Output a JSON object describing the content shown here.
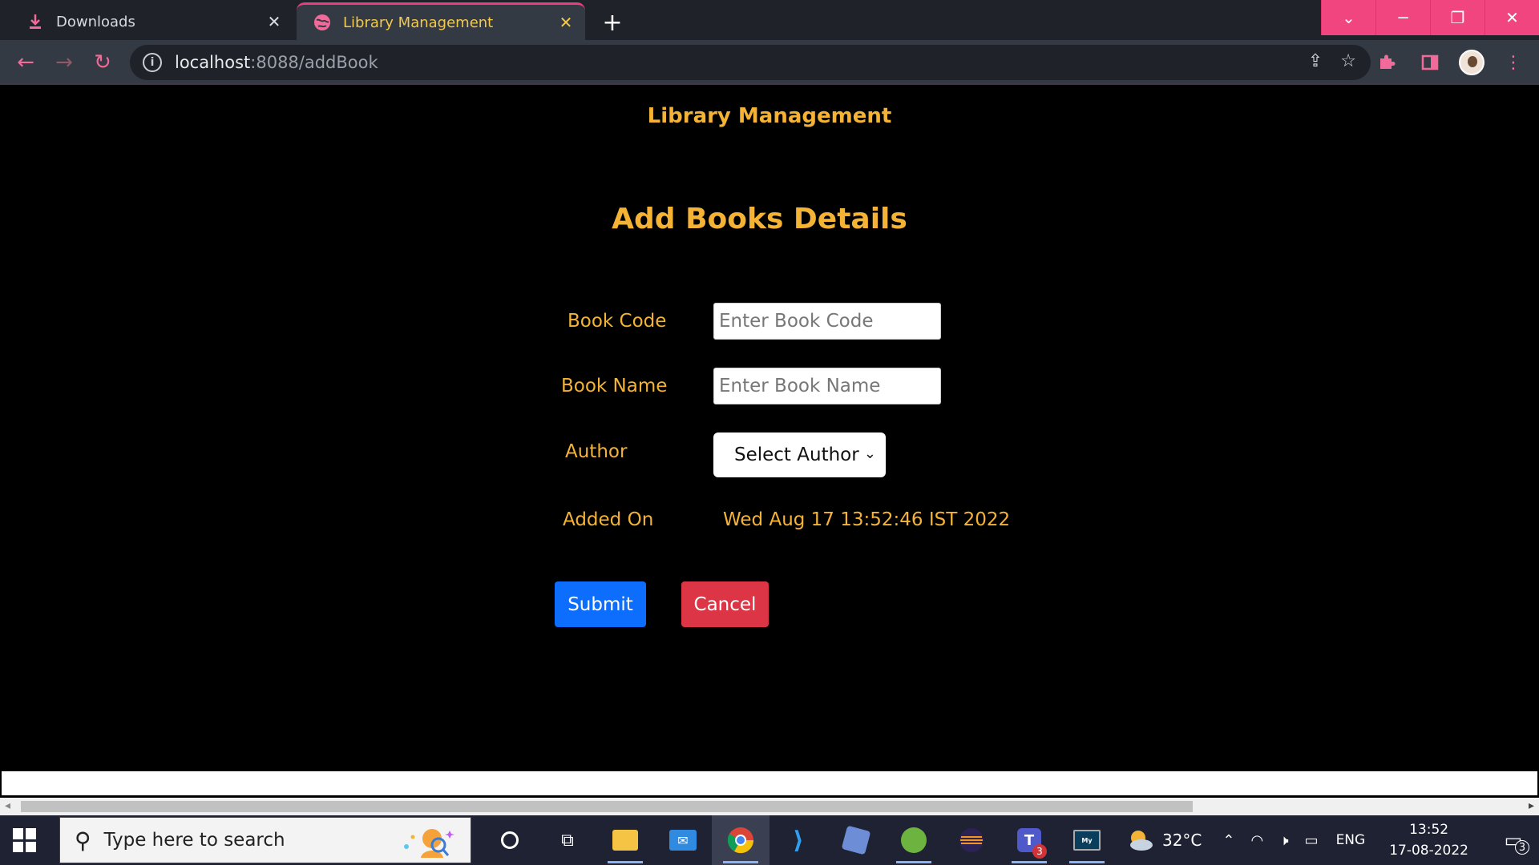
{
  "browser": {
    "tabs": [
      {
        "title": "Downloads",
        "icon": "download-icon"
      },
      {
        "title": "Library Management",
        "icon": "globe-icon",
        "active": true
      }
    ],
    "url_host": "localhost",
    "url_path": ":8088/addBook",
    "accent_color": "#f1457f"
  },
  "page": {
    "brand": "Library Management",
    "heading": "Add Books Details",
    "form": {
      "book_code_label": "Book Code",
      "book_code_placeholder": "Enter Book Code",
      "book_name_label": "Book Name",
      "book_name_placeholder": "Enter Book Name",
      "author_label": "Author",
      "author_selected": "Select Author",
      "added_on_label": "Added On",
      "added_on_value": "Wed Aug 17 13:52:46 IST 2022",
      "submit_label": "Submit",
      "cancel_label": "Cancel"
    },
    "colors": {
      "text": "#f5b335",
      "submit": "#0d6efd",
      "cancel": "#dc3545"
    }
  },
  "taskbar": {
    "search_placeholder": "Type here to search",
    "apps": [
      "cortana-icon",
      "task-view-icon",
      "file-explorer-icon",
      "mail-icon",
      "chrome-icon",
      "vscode-icon",
      "virtualbox-icon",
      "spring-tool-suite-icon",
      "eclipse-icon",
      "teams-icon",
      "mysql-workbench-icon"
    ],
    "teams_badge": "3",
    "temperature": "32°C",
    "language": "ENG",
    "time": "13:52",
    "date": "17-08-2022",
    "notification_count": "3"
  }
}
